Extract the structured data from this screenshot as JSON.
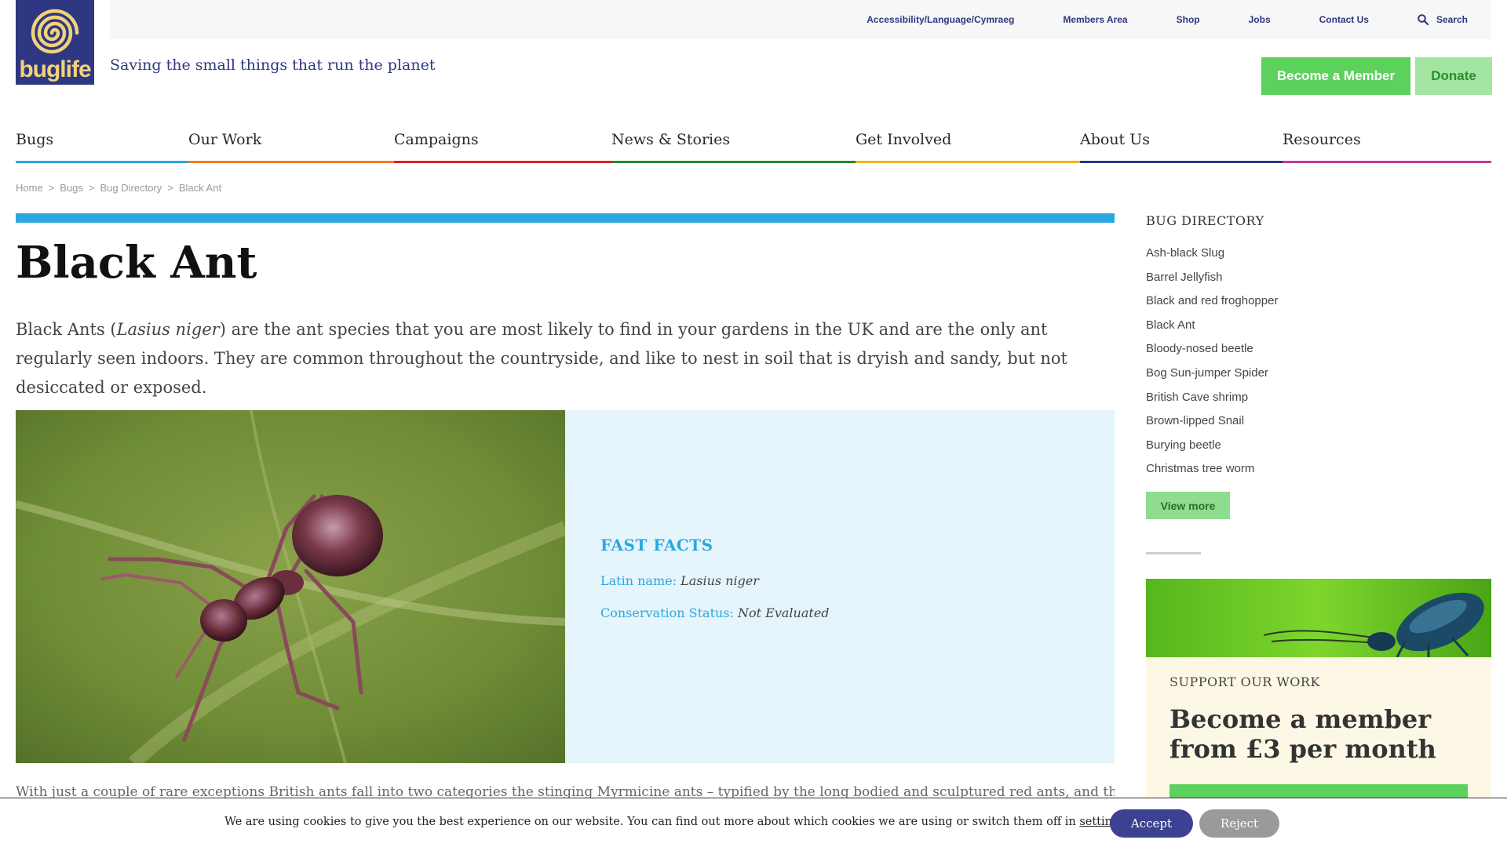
{
  "logo": {
    "text": "buglife"
  },
  "utility_nav": [
    {
      "label": "Accessibility/Language/Cymraeg"
    },
    {
      "label": "Members Area"
    },
    {
      "label": "Shop"
    },
    {
      "label": "Jobs"
    },
    {
      "label": "Contact Us"
    },
    {
      "label": "Search",
      "icon": "search-icon"
    }
  ],
  "tagline": "Saving the small things that run the planet",
  "header_buttons": {
    "member": "Become a Member",
    "donate": "Donate"
  },
  "main_nav": [
    {
      "label": "Bugs",
      "color": "#29a8e0"
    },
    {
      "label": "Our Work",
      "color": "#f07d1f"
    },
    {
      "label": "Campaigns",
      "color": "#d8232a"
    },
    {
      "label": "News & Stories",
      "color": "#2a8a2a"
    },
    {
      "label": "Get Involved",
      "color": "#f5b31c"
    },
    {
      "label": "About Us",
      "color": "#2e3781"
    },
    {
      "label": "Resources",
      "color": "#c33b93"
    }
  ],
  "breadcrumb": [
    "Home",
    "Bugs",
    "Bug Directory",
    "Black Ant"
  ],
  "breadcrumb_sep": ">",
  "page": {
    "title": "Black Ant",
    "intro_before": "Black Ants (",
    "intro_italic": "Lasius niger",
    "intro_after": ") are the ant species that you are most likely to find in your gardens in the UK and are the only ant regularly seen indoors. They are common throughout the countryside, and like to nest in soil that is dryish and sandy, but not desiccated or exposed.",
    "body": "With just a couple of rare exceptions British ants fall into two categories the stinging Myrmicine ants – typified by the long bodied and sculptured red ants, and the non-stinging"
  },
  "fast_facts": {
    "title": "FAST FACTS",
    "latin_label": "Latin name:",
    "latin_value": "Lasius niger",
    "status_label": "Conservation Status:",
    "status_value": "Not Evaluated"
  },
  "sidebar": {
    "title": "BUG DIRECTORY",
    "items": [
      "Ash-black Slug",
      "Barrel Jellyfish",
      "Black and red froghopper",
      "Black Ant",
      "Bloody-nosed beetle",
      "Bog Sun-jumper Spider",
      "British Cave shrimp",
      "Brown-lipped Snail",
      "Burying beetle",
      "Christmas tree worm"
    ],
    "view_more": "View more"
  },
  "support": {
    "kicker": "SUPPORT OUR WORK",
    "heading": "Become a member from £3 per month"
  },
  "cookie": {
    "text": "We are using cookies to give you the best experience on our website. You can find out more about which cookies we are using or switch them off in",
    "link": "settings",
    "end": ".",
    "accept": "Accept",
    "reject": "Reject"
  },
  "colors": {
    "brand_navy": "#2e3781",
    "green": "#5cd15c",
    "blue": "#29a8e0"
  }
}
